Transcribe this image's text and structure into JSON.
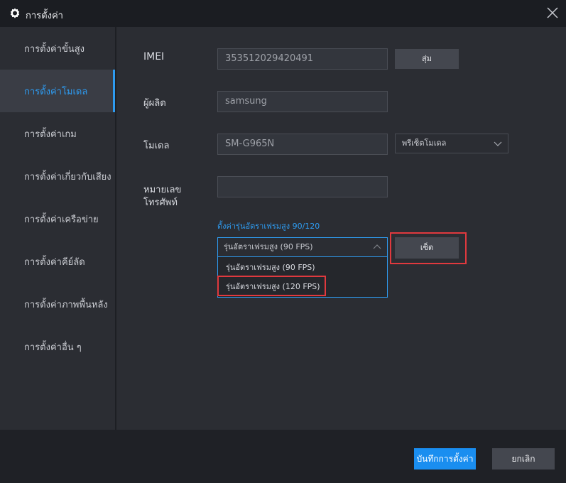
{
  "window": {
    "title": "การตั้งค่า"
  },
  "sidebar": {
    "items": [
      {
        "label": "การตั้งค่าขั้นสูง"
      },
      {
        "label": "การตั้งค่าโมเดล"
      },
      {
        "label": "การตั้งค่าเกม"
      },
      {
        "label": "การตั้งค่าเกี่ยวกับเสียง"
      },
      {
        "label": "การตั้งค่าเครือข่าย"
      },
      {
        "label": "การตั้งค่าคีย์ลัด"
      },
      {
        "label": "การตั้งค่าภาพพื้นหลัง"
      },
      {
        "label": "การตั้งค่าอื่น ๆ"
      }
    ],
    "active_index": 1
  },
  "form": {
    "imei": {
      "label": "IMEI",
      "value": "353512029420491",
      "button": "สุ่ม"
    },
    "manufacturer": {
      "label": "ผู้ผลิต",
      "value": "samsung"
    },
    "model": {
      "label": "โมเดล",
      "value": "SM-G965N",
      "preset_label": "พรีเซ็ตโมเดล"
    },
    "phone": {
      "label_line1": "หมายเลข",
      "label_line2": "โทรศัพท์",
      "value": ""
    },
    "fps": {
      "link": "ตั้งค่ารุ่นอัตราเฟรมสูง 90/120",
      "selected": "รุ่นอัตราเฟรมสูง (90 FPS)",
      "options": [
        "รุ่นอัตราเฟรมสูง (90 FPS)",
        "รุ่นอัตราเฟรมสูง (120 FPS)"
      ],
      "apply_button": "เซ็ต"
    }
  },
  "footer": {
    "save": "บันทึกการตั้งค่า",
    "cancel": "ยกเลิก"
  },
  "colors": {
    "accent": "#2e9bf0",
    "highlight": "#e0393e",
    "primary_button": "#1a8ef0"
  }
}
